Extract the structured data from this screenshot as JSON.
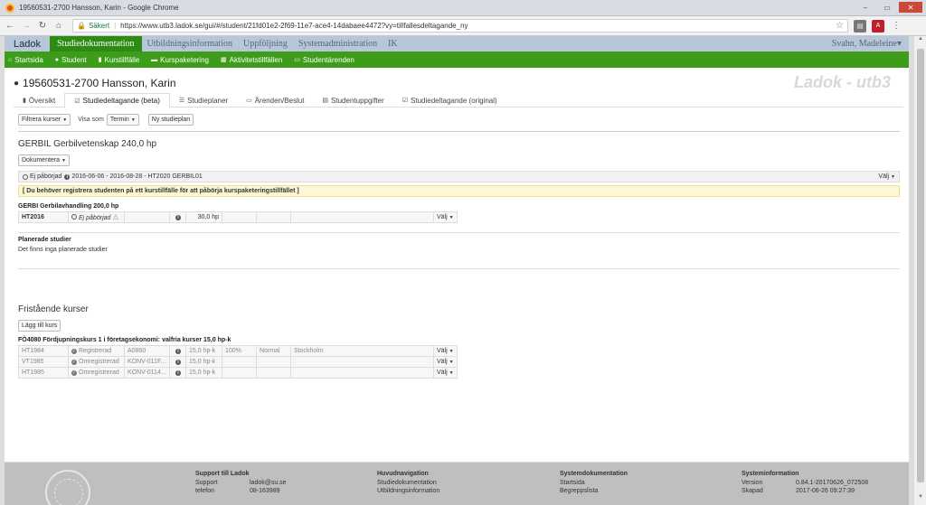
{
  "window": {
    "title": "19560531-2700 Hansson, Karin - Google Chrome",
    "controls": [
      "–",
      "▭",
      "✕"
    ]
  },
  "browser": {
    "secure_label": "Säkert",
    "url": "https://www.utb3.ladok.se/gui/#/student/21fd01e2-2f69-11e7-ace4-14dabaee4472?vy=tillfallesdeltagande_ny"
  },
  "topnav": {
    "brand": "Ladok",
    "items": [
      "Studiedokumentation",
      "Utbildningsinformation",
      "Uppföljning",
      "Systemadministration",
      "IK"
    ],
    "active_index": 0,
    "user": "Svahn, Madeleine▾"
  },
  "subnav": {
    "items": [
      {
        "label": "Startsida",
        "icon": "home-icon"
      },
      {
        "label": "Student",
        "icon": "user-icon"
      },
      {
        "label": "Kurstillfälle",
        "icon": "book-icon"
      },
      {
        "label": "Kurspaketering",
        "icon": "folder-icon"
      },
      {
        "label": "Aktivitetstillfällen",
        "icon": "calendar-icon"
      },
      {
        "label": "Studentärenden",
        "icon": "inbox-icon"
      }
    ]
  },
  "student": {
    "heading": "19560531-2700 Hansson, Karin",
    "watermark": "Ladok - utb3"
  },
  "tabs": [
    {
      "label": "Översikt",
      "icon": "book-icon"
    },
    {
      "label": "Studiedeltagande (beta)",
      "icon": "checkbox-icon",
      "active": true
    },
    {
      "label": "Studieplaner",
      "icon": "list-icon"
    },
    {
      "label": "Ärenden/Beslut",
      "icon": "inbox-icon"
    },
    {
      "label": "Studentuppgifter",
      "icon": "document-icon"
    },
    {
      "label": "Studiedeltagande (original)",
      "icon": "checkbox-icon"
    }
  ],
  "toolbar": {
    "filter_label": "Filtrera kurser",
    "show_as_label": "Visa som",
    "show_as_value": "Termin",
    "new_plan_label": "Ny studieplan"
  },
  "program": {
    "title": "GERBIL Gerbilvetenskap 240,0 hp",
    "document_label": "Dokumentera",
    "status_text": "Ej påbörjad",
    "status_details": "2016-06-06 - 2016-08-28 - HT2020 GERBIL01",
    "choose_label": "Välj",
    "warning": "[ Du behöver registrera studenten på ett kurstillfälle för att påbörja kurspaketeringstillfället ]"
  },
  "thesis": {
    "title": "GERBI Gerbilavhandling 200,0 hp",
    "row": {
      "term": "HT2016",
      "status": "Ej påbörjad",
      "credits": "30,0 hp",
      "choose": "Välj"
    }
  },
  "planned": {
    "title": "Planerade studier",
    "empty_text": "Det finns inga planerade studier"
  },
  "free_courses": {
    "title": "Fristående kurser",
    "add_label": "Lägg till kurs",
    "course_title": "FÖ4080 Fördjupningskurs 1 i företagsekonomi: valfria kurser 15,0 hp-k",
    "rows": [
      {
        "term": "HT1984",
        "status": "Registrerad",
        "code": "A0860",
        "credits": "15,0 hp-k",
        "pace": "100%",
        "form": "Normal",
        "place": "Stockholm",
        "choose": "Välj"
      },
      {
        "term": "VT1985",
        "status": "Omregistrerad",
        "code": "KONV-011F...",
        "credits": "15,0 hp-k",
        "pace": "",
        "form": "",
        "place": "",
        "choose": "Välj"
      },
      {
        "term": "HT1985",
        "status": "Omregistrerad",
        "code": "KONV-0114...",
        "credits": "15,0 hp-k",
        "pace": "",
        "form": "",
        "place": "",
        "choose": "Välj"
      }
    ]
  },
  "footer": {
    "support": {
      "title": "Support till Ladok",
      "rows": [
        {
          "k": "Support",
          "v": "ladok@su.se"
        },
        {
          "k": "telefon",
          "v": "08-163989"
        }
      ]
    },
    "mainnav": {
      "title": "Huvudnavigation",
      "items": [
        "Studiedokumentation",
        "Utbildningsinformation"
      ]
    },
    "sysdoc": {
      "title": "Systemdokumentation",
      "items": [
        "Startsida",
        "Begreppslista"
      ]
    },
    "sysinfo": {
      "title": "Systeminformation",
      "rows": [
        {
          "k": "Version",
          "v": "0.84.1-20170626_072508"
        },
        {
          "k": "Skapad",
          "v": "2017-06-26 09:27:39"
        }
      ]
    }
  }
}
